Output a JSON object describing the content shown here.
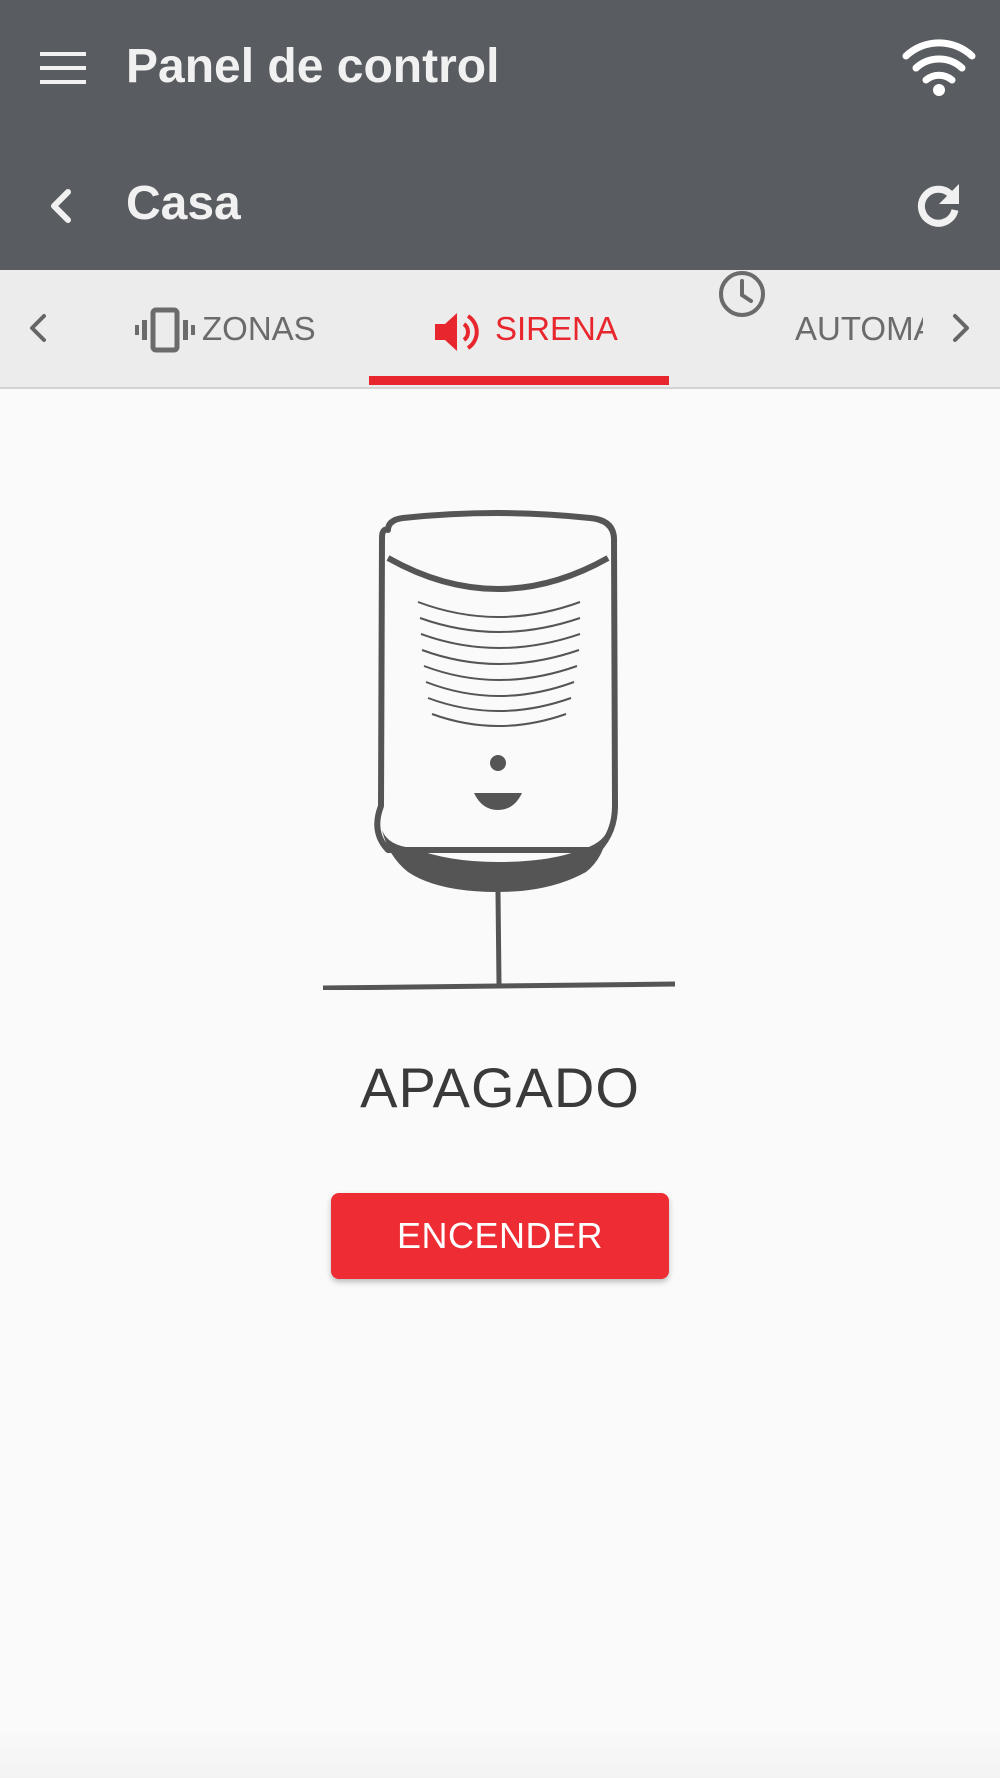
{
  "header": {
    "title": "Panel de control",
    "subtitle": "Casa",
    "icons": {
      "menu": "hamburger-menu-icon",
      "wifi": "wifi-icon",
      "back": "chevron-left-icon",
      "refresh": "refresh-icon"
    }
  },
  "tabs": {
    "items": [
      {
        "label": "ZONAS",
        "icon": "vibration-phone-icon",
        "active": false
      },
      {
        "label": "SIRENA",
        "icon": "speaker-icon",
        "active": true
      },
      {
        "label": "AUTOMA",
        "icon": "clock-icon",
        "active": false
      }
    ],
    "prev_icon": "chevron-left-icon",
    "next_icon": "chevron-right-icon"
  },
  "siren": {
    "status": "APAGADO",
    "action_label": "ENCENDER"
  },
  "colors": {
    "appbar": "#595c60",
    "accent": "#e8262e",
    "button": "#ee2c34",
    "tabbar": "#ececec",
    "background": "#fafafa"
  }
}
